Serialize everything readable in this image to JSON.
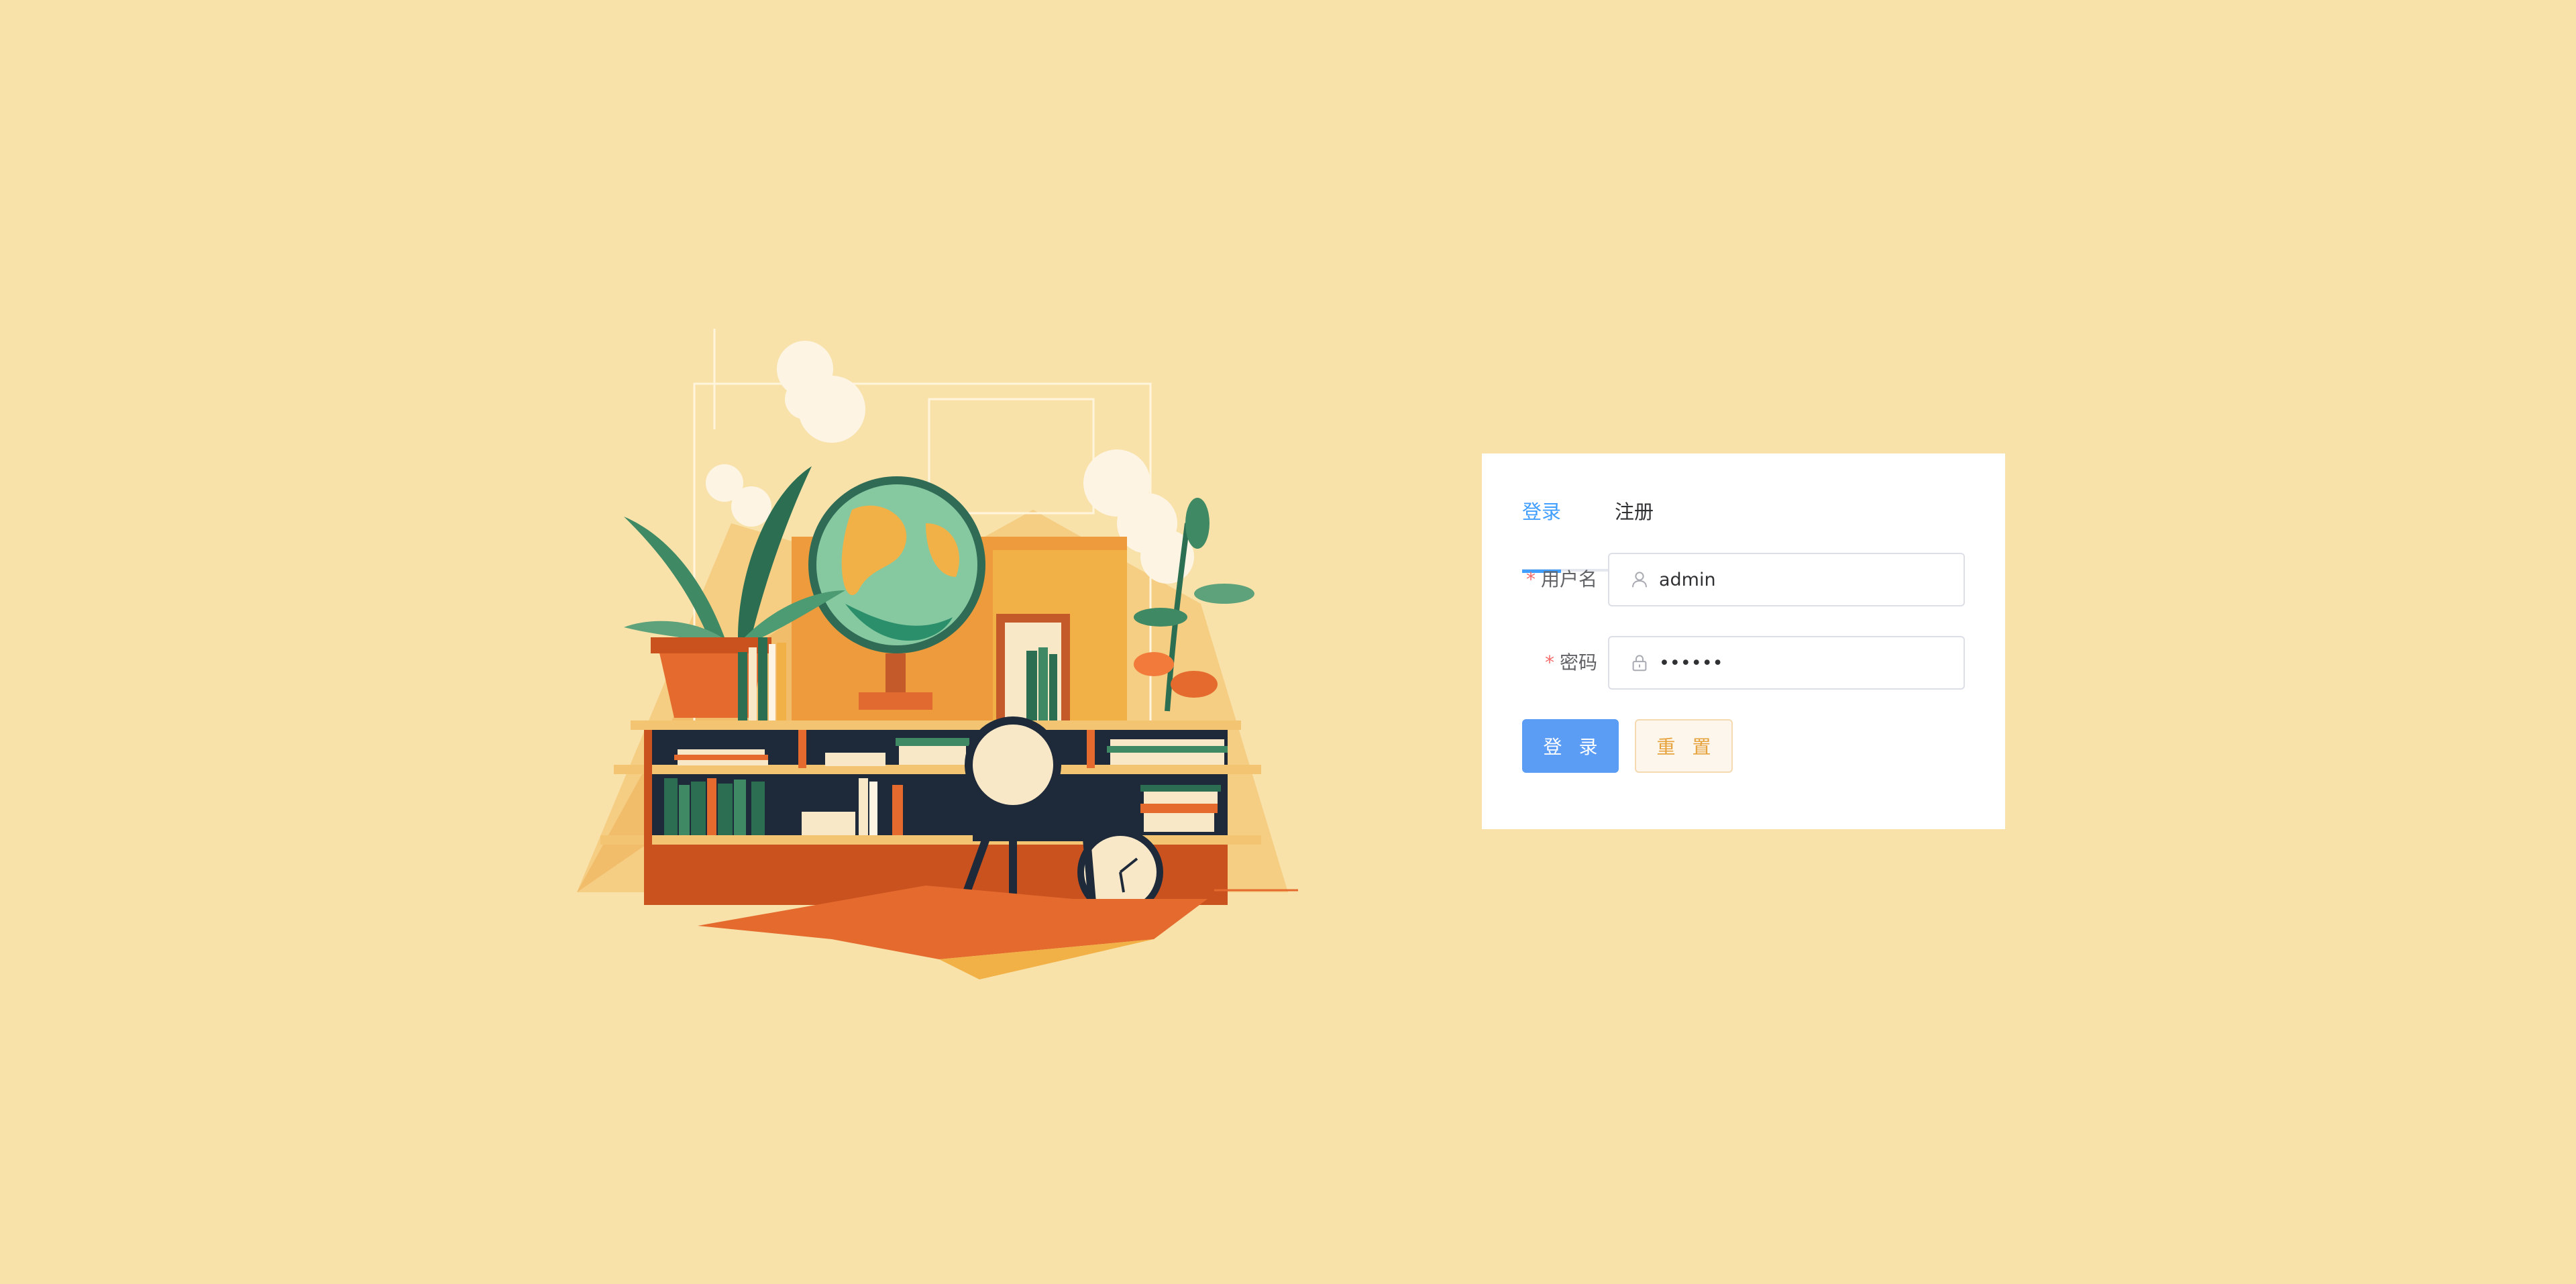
{
  "tabs": [
    {
      "label": "登录",
      "active": true
    },
    {
      "label": "注册",
      "active": false
    }
  ],
  "form": {
    "username": {
      "label": "用户名",
      "required_mark": "*",
      "value": "admin",
      "icon": "user-icon"
    },
    "password": {
      "label": "密码",
      "required_mark": "*",
      "value": "••••••",
      "icon": "lock-icon"
    }
  },
  "buttons": {
    "login_label": "登 录",
    "reset_label": "重 置"
  },
  "colors": {
    "background": "#f8e2aa",
    "primary": "#409eff",
    "primary_button": "#5b9cf5",
    "warning_text": "#e6a23c",
    "required": "#f56c6c"
  }
}
